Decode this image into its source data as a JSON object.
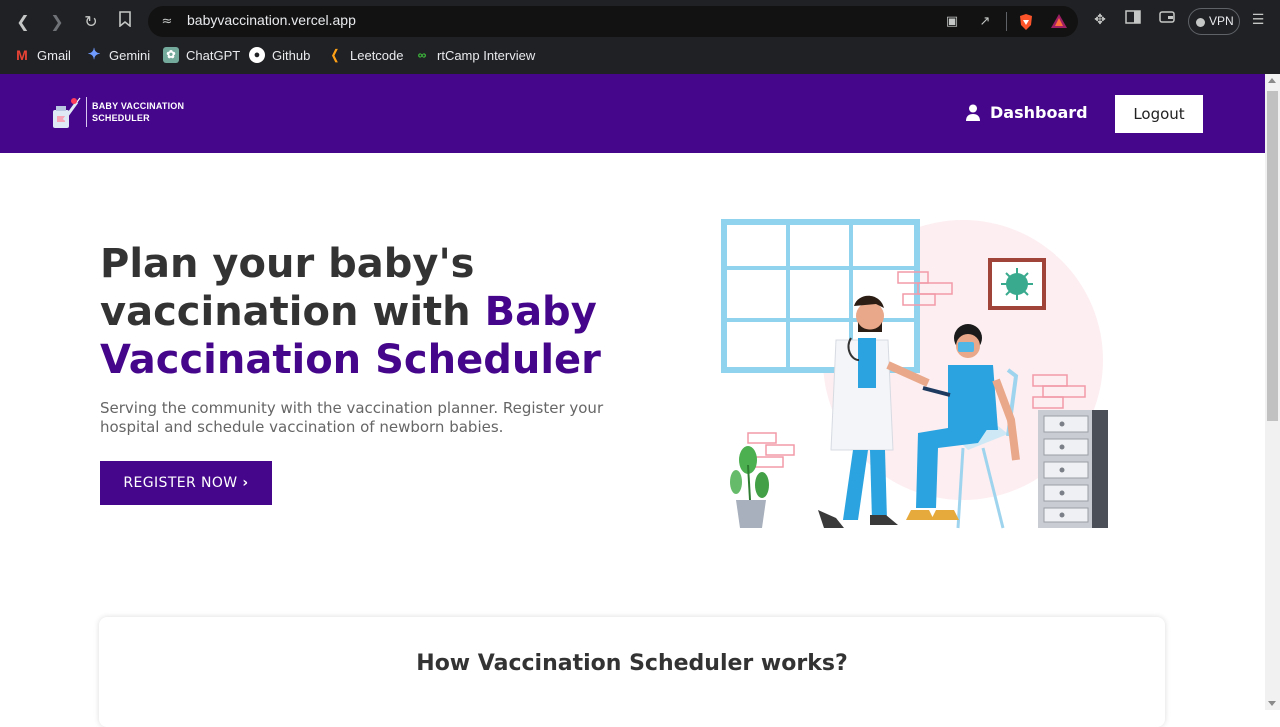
{
  "browser": {
    "url": "babyvaccination.vercel.app",
    "vpn_label": "VPN",
    "bookmarks": [
      {
        "label": "Gmail",
        "icon": "gmail-icon"
      },
      {
        "label": "Gemini",
        "icon": "gemini-icon"
      },
      {
        "label": "ChatGPT",
        "icon": "chatgpt-icon"
      },
      {
        "label": "Github",
        "icon": "github-icon"
      },
      {
        "label": "Leetcode",
        "icon": "leetcode-icon"
      },
      {
        "label": "rtCamp Interview",
        "icon": "rtcamp-icon"
      }
    ]
  },
  "header": {
    "logo_line1": "BABY VACCINATION",
    "logo_line2": "SCHEDULER",
    "dashboard_label": "Dashboard",
    "logout_label": "Logout",
    "brand_color": "#45068b"
  },
  "hero": {
    "title_line1": "Plan your baby's",
    "title_line2_plain": "vaccination with ",
    "title_line2_accent": "Baby",
    "title_line3_accent": "Vaccination Scheduler",
    "subtitle": "Serving the community with the vaccination planner. Register your hospital and schedule vaccination of newborn babies.",
    "register_label": "REGISTER NOW"
  },
  "how": {
    "title": "How Vaccination Scheduler works?"
  }
}
